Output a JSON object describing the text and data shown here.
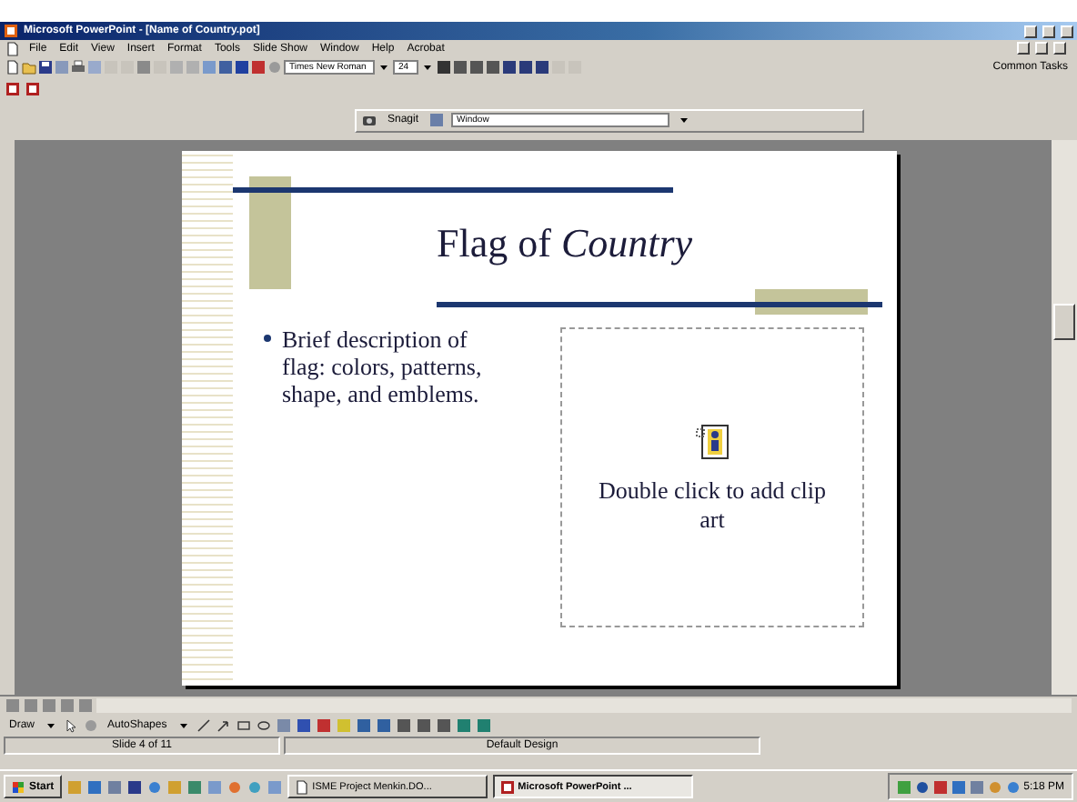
{
  "window": {
    "title": "Microsoft PowerPoint - [Name of Country.pot]"
  },
  "menu": [
    "File",
    "Edit",
    "View",
    "Insert",
    "Format",
    "Tools",
    "Slide Show",
    "Window",
    "Help",
    "Acrobat"
  ],
  "toolbar": {
    "font": "Times New Roman",
    "size": "24",
    "common_tasks": "Common Tasks"
  },
  "snagit": {
    "label": "Snagit",
    "mode": "Window"
  },
  "slide": {
    "title": "Flag of *Country*",
    "bullets": [
      "Brief description of flag: colors, patterns, shape, and emblems."
    ],
    "placeholder": "Double click to add clip art"
  },
  "drawing_toolbar": {
    "draw": "Draw",
    "autoshapes": "AutoShapes"
  },
  "status_bar": [
    "Slide 4 of 11",
    "Default Design"
  ],
  "taskbar": {
    "start": "Start",
    "tasks": [
      {
        "label": "ISME Project Menkin.DO...",
        "selected": false
      },
      {
        "label": "Microsoft PowerPoint ...",
        "selected": true
      }
    ],
    "clock": "5:18 PM"
  }
}
